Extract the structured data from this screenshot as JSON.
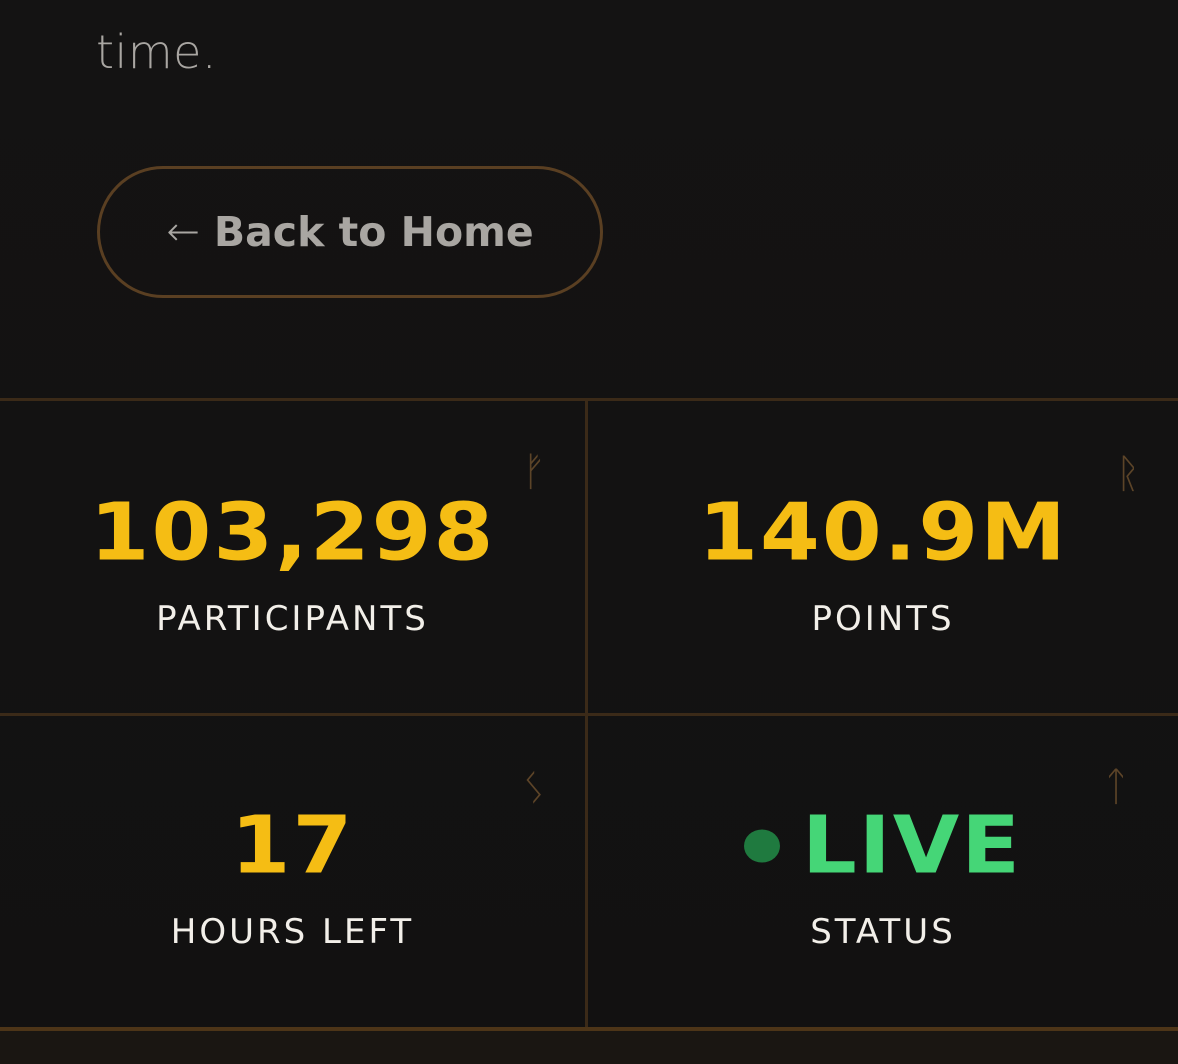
{
  "intro": {
    "text_tail": "time."
  },
  "back_button": {
    "arrow": "←",
    "label": "Back to Home"
  },
  "stats": {
    "participants": {
      "value": "103,298",
      "label": "PARTICIPANTS",
      "rune": "ᚠ"
    },
    "points": {
      "value": "140.9M",
      "label": "POINTS",
      "rune": "ᚱ"
    },
    "hours": {
      "value": "17",
      "label": "HOURS LEFT",
      "rune": "ᛊ"
    },
    "status": {
      "value": "LIVE",
      "label": "STATUS",
      "rune": "ᛏ"
    }
  },
  "colors": {
    "accent_gold": "#f5bd14",
    "live_green": "#45d677",
    "live_dot": "#1f7a3f",
    "border_brown": "#3b2a18"
  }
}
